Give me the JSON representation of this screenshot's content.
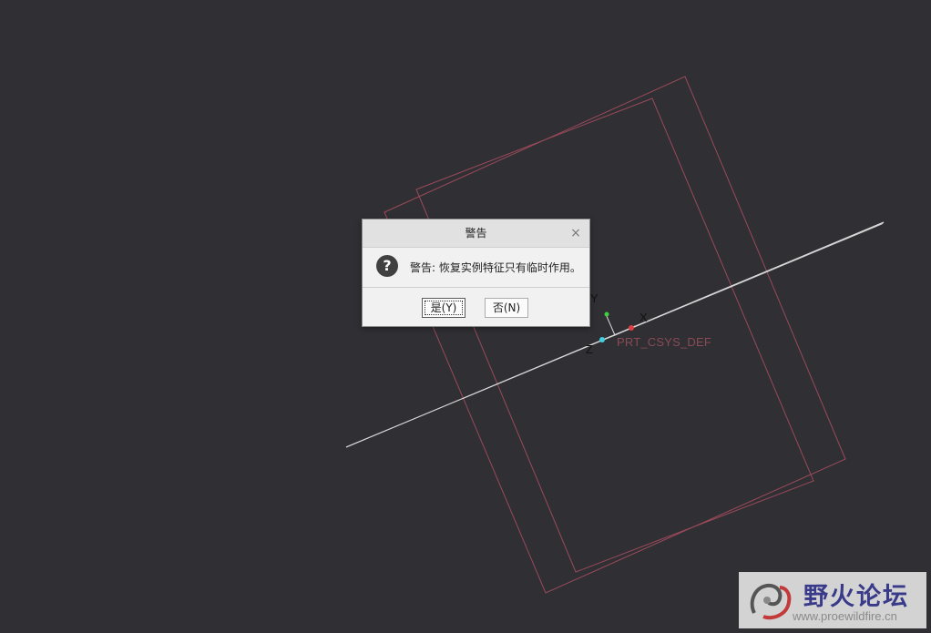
{
  "viewport": {
    "background": "#2f2f34",
    "csys_label": "PRT_CSYS_DEF",
    "axes": {
      "x": "X",
      "y": "Y",
      "z": "Z"
    },
    "colors": {
      "datum_plane": "#9a4a5a",
      "datum_axis": "#d8d8d8",
      "x_axis": "#e04040",
      "y_axis": "#40d040",
      "z_axis": "#40d0e0"
    }
  },
  "dialog": {
    "title": "警告",
    "close_icon": "close-icon",
    "icon": "question-icon",
    "icon_glyph": "?",
    "message": "警告: 恢复实例特征只有临时作用。",
    "buttons": {
      "yes": "是(Y)",
      "no": "否(N)"
    }
  },
  "watermark": {
    "title": "野火论坛",
    "url": "www.proewildfire.cn"
  }
}
